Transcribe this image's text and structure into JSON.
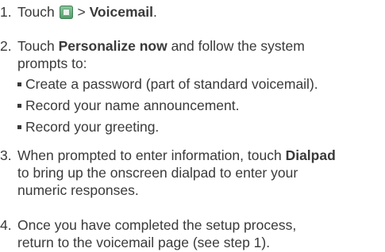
{
  "steps": [
    {
      "number": "1.",
      "pre": "Touch",
      "icon": "apps-launcher-icon",
      "sep": ">",
      "bold": "Voicemail",
      "post": "."
    },
    {
      "number": "2.",
      "pre": "Touch",
      "bold": "Personalize now",
      "post_line1": "and follow the system",
      "line2": "prompts to:",
      "bullets": [
        "Create a password (part of standard voicemail).",
        "Record your name announcement.",
        "Record your greeting."
      ]
    },
    {
      "number": "3.",
      "line1": "When prompted to enter information, touch",
      "bold": "Dialpad",
      "line2": "to bring up the onscreen dialpad to enter your",
      "line3": "numeric responses."
    },
    {
      "number": "4.",
      "line1": "Once you have completed the setup process,",
      "line2": "return to the voicemail page (see step 1)."
    }
  ]
}
